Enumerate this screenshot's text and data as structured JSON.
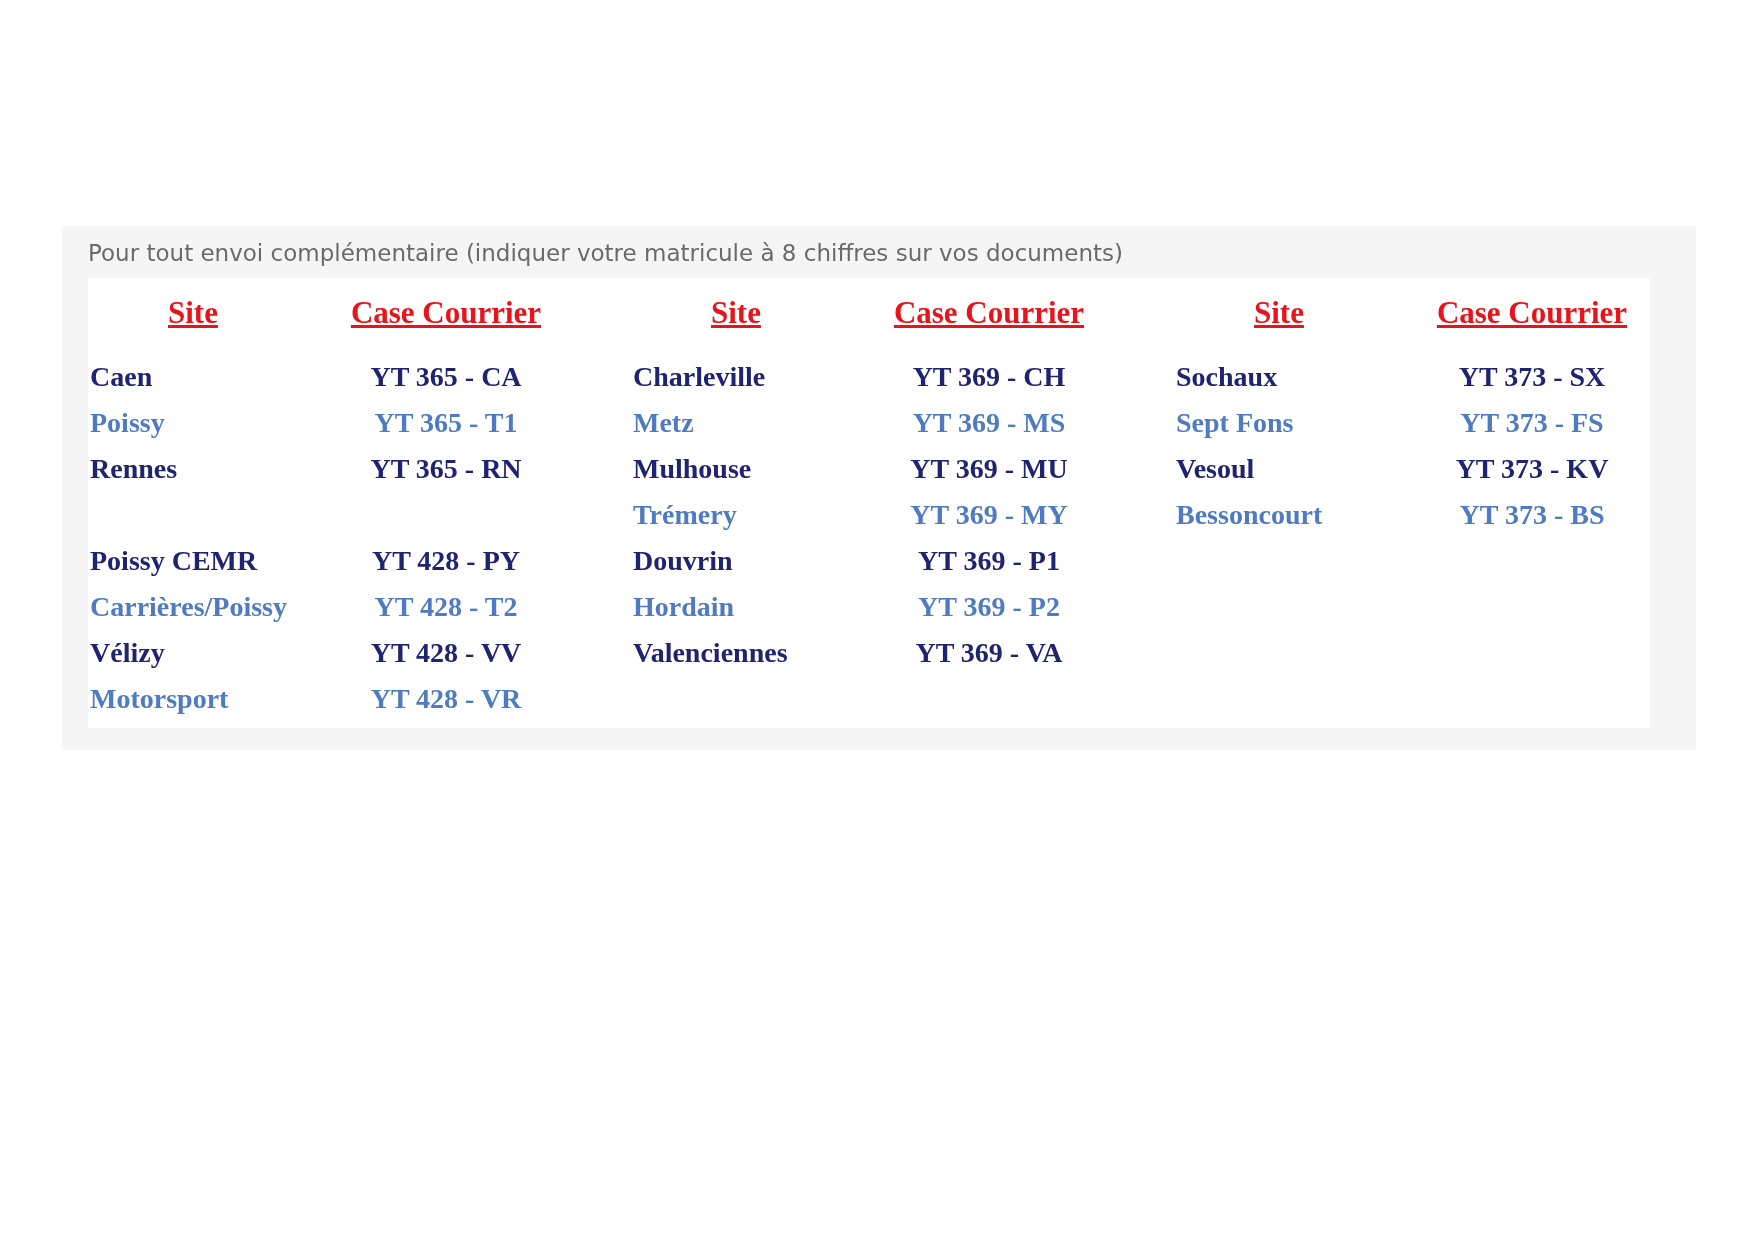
{
  "caption": "Pour tout envoi complémentaire (indiquer votre matricule à 8 chiffres sur vos documents)",
  "groups": [
    {
      "header": {
        "site": "Site",
        "code": "Case Courrier"
      },
      "blocks": [
        [
          {
            "site": "Caen",
            "code": "YT 365 - CA",
            "color": "#1f2370"
          },
          {
            "site": "Poissy",
            "code": "YT 365 - T1",
            "color": "#4f7bc0"
          },
          {
            "site": "Rennes",
            "code": "YT 365 - RN",
            "color": "#1f2370"
          }
        ],
        [
          {
            "site": "Poissy CEMR",
            "code": "YT 428 - PY",
            "color": "#1f2370"
          },
          {
            "site": "Carrières/Poissy",
            "code": "YT 428 - T2",
            "color": "#4f7bc0"
          },
          {
            "site": "Vélizy",
            "code": "YT 428 - VV",
            "color": "#1f2370"
          },
          {
            "site": "Motorsport",
            "code": "YT 428 - VR",
            "color": "#4f7bc0"
          }
        ]
      ]
    },
    {
      "header": {
        "site": "Site",
        "code": "Case Courrier"
      },
      "blocks": [
        [
          {
            "site": "Charleville",
            "code": "YT 369 - CH",
            "color": "#1f2370"
          },
          {
            "site": "Metz",
            "code": "YT 369 - MS",
            "color": "#4f7bc0"
          },
          {
            "site": "Mulhouse",
            "code": "YT 369 - MU",
            "color": "#1f2370"
          },
          {
            "site": "Trémery",
            "code": "YT 369 - MY",
            "color": "#4f7bc0"
          },
          {
            "site": "Douvrin",
            "code": "YT 369 - P1",
            "color": "#1f2370"
          },
          {
            "site": "Hordain",
            "code": "YT 369 - P2",
            "color": "#4f7bc0"
          },
          {
            "site": "Valenciennes",
            "code": "YT 369 - VA",
            "color": "#1f2370"
          }
        ]
      ]
    },
    {
      "header": {
        "site": "Site",
        "code": "Case Courrier"
      },
      "blocks": [
        [
          {
            "site": "Sochaux",
            "code": "YT 373 - SX",
            "color": "#1f2370"
          },
          {
            "site": "Sept Fons",
            "code": "YT 373 - FS",
            "color": "#4f7bc0"
          },
          {
            "site": "Vesoul",
            "code": "YT 373 - KV",
            "color": "#1f2370"
          },
          {
            "site": "Bessoncourt",
            "code": "YT 373 - BS",
            "color": "#4f7bc0"
          }
        ]
      ]
    }
  ]
}
